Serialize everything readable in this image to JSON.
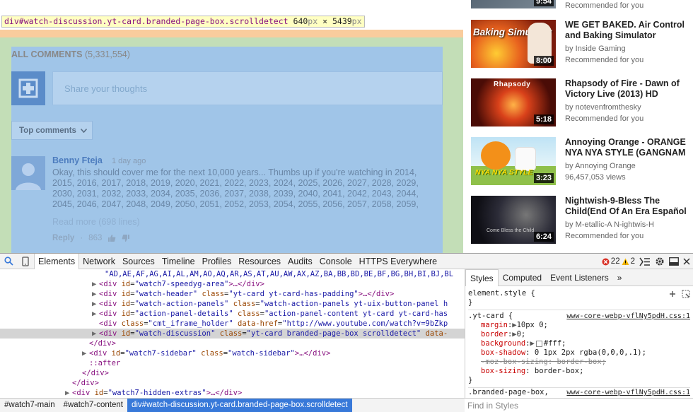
{
  "inspect_tooltip": {
    "selector": "div#watch-discussion.yt-card.branded-page-box.scrolldetect",
    "width": "640",
    "height": "5439",
    "unit": "px",
    "separator": "×"
  },
  "comments": {
    "header": "ALL COMMENTS",
    "count": "(5,331,554)",
    "share_placeholder": "Share your thoughts",
    "sort_label": "Top comments",
    "comment": {
      "author": "Benny Fteja",
      "time": "1 day ago",
      "body": "Okay, this should cover me for the next 10,000 years... Thumbs up if you're watching in 2014, 2015, 2016, 2017, 2018, 2019, 2020, 2021, 2022, 2023, 2024, 2025, 2026, 2027, 2028, 2029, 2030, 2031, 2032, 2033, 2034, 2035, 2036, 2037, 2038, 2039, 2040, 2041, 2042, 2043, 2044, 2045, 2046, 2047, 2048, 2049, 2050, 2051, 2052, 2053, 2054, 2055, 2056, 2057, 2058, 2059,",
      "read_more": "Read more (698 lines)",
      "reply": "Reply",
      "separator": "·",
      "likes": "863"
    }
  },
  "sidebar": {
    "videos": [
      {
        "title1": "",
        "title2": "",
        "channel": "",
        "meta": "Recommended for you",
        "duration": "9:54",
        "thumb_color": "#5a6a7a"
      },
      {
        "title1": "WE GET BAKED. Air Control",
        "title2": "and Baking Simulator",
        "channel": "by Inside Gaming",
        "meta": "Recommended for you",
        "duration": "8:00",
        "thumb_text": "Baking Simulator",
        "thumb_color": "#c8431b"
      },
      {
        "title1": "Rhapsody of Fire - Dawn of",
        "title2": "Victory Live (2013) HD",
        "channel": "by notevenfromthesky",
        "meta": "Recommended for you",
        "duration": "5:18",
        "thumb_text": "Rhapsody",
        "thumb_color": "#8a1a0e"
      },
      {
        "title1": "Annoying Orange - ORANGE",
        "title2": "NYA NYA STYLE (GANGNAM",
        "channel": "by Annoying Orange",
        "meta": "96,457,053 views",
        "duration": "3:23",
        "thumb_text": "NYA NYA STYLE",
        "thumb_color": "#6ea33b"
      },
      {
        "title1": "Nightwish-9-Bless The",
        "title2": "Child(End Of An Era Español",
        "channel": "by M-etallic-A N-ightwis-H",
        "meta": "Recommended for you",
        "duration": "6:24",
        "thumb_text": "Come Bless the Child",
        "thumb_color": "#1f1f2a"
      }
    ]
  },
  "devtools": {
    "tabs": [
      "Elements",
      "Network",
      "Sources",
      "Timeline",
      "Profiles",
      "Resources",
      "Audits",
      "Console",
      "HTTPS Everywhere"
    ],
    "active_tab": "Elements",
    "errors": "22",
    "warnings": "2",
    "dom_lines": [
      {
        "indent": 20,
        "text": "\"AD,AE,AF,AG,AI,AL,AM,AO,AQ,AR,AS,AT,AU,AW,AX,AZ,BA,BB,BD,BE,BF,BG,BH,BI,BJ,BL",
        "type": "text"
      },
      {
        "indent": 16,
        "id": "watch7-speedyg-area",
        "class": null,
        "tail": ">…</div>"
      },
      {
        "indent": 16,
        "id": "watch-header",
        "class": "yt-card yt-card-has-padding",
        "tail": ">…</div>"
      },
      {
        "indent": 16,
        "id": "watch-action-panels",
        "class": "watch-action-panels yt-uix-button-panel h",
        "tail": ""
      },
      {
        "indent": 16,
        "id": "action-panel-details",
        "class": "action-panel-content yt-card yt-card-has",
        "tail": ""
      },
      {
        "indent": 18,
        "id": null,
        "class": "cmt_iframe_holder",
        "extra_attr": "data-href",
        "extra_val": "http://www.youtube.com/watch?v=9bZkp",
        "tail": ""
      },
      {
        "indent": 16,
        "id": "watch-discussion",
        "class": "yt-card branded-page-box scrolldetect",
        "extra_attr": "data-",
        "tail": "",
        "selected": true
      },
      {
        "indent": 14,
        "close": "</div>"
      },
      {
        "indent": 12,
        "id": "watch7-sidebar",
        "class": "watch-sidebar",
        "tail": ">…</div>"
      },
      {
        "indent": 12,
        "pseudo": "::after"
      },
      {
        "indent": 10,
        "close": "</div>"
      },
      {
        "indent": 8,
        "close": "</div>"
      },
      {
        "indent": 8,
        "id": "watch7-hidden-extras",
        "class": null,
        "tail": ">…</div>"
      }
    ],
    "styles_tabs": [
      "Styles",
      "Computed",
      "Event Listeners"
    ],
    "styles_active": "Styles",
    "element_style": "element.style {",
    "rule": {
      "selector": ".yt-card {",
      "source": "www-core-webp-vflNy5pdH.css:1",
      "props": [
        {
          "name": "margin",
          "value": "10px 0;",
          "arrow": true
        },
        {
          "name": "border",
          "value": "0;",
          "arrow": true
        },
        {
          "name": "background",
          "value": "#fff;",
          "arrow": true,
          "swatch": "#ffffff"
        },
        {
          "name": "box-shadow",
          "value": "0 1px 2px  rgba(0,0,0,.1);",
          "swatch": "#cccccc"
        },
        {
          "name": "-moz-box-sizing",
          "value": "border-box;",
          "strike": true
        },
        {
          "name": "box-sizing",
          "value": "border-box;"
        }
      ],
      "close": "}"
    },
    "next_rule": ".branded-page-box,",
    "next_source": "www-core-webp-vflNy5pdH.css:1",
    "find_placeholder": "Find in Styles",
    "breadcrumbs": [
      "#watch7-main",
      "#watch7-content",
      "div#watch-discussion.yt-card.branded-page-box.scrolldetect"
    ]
  }
}
